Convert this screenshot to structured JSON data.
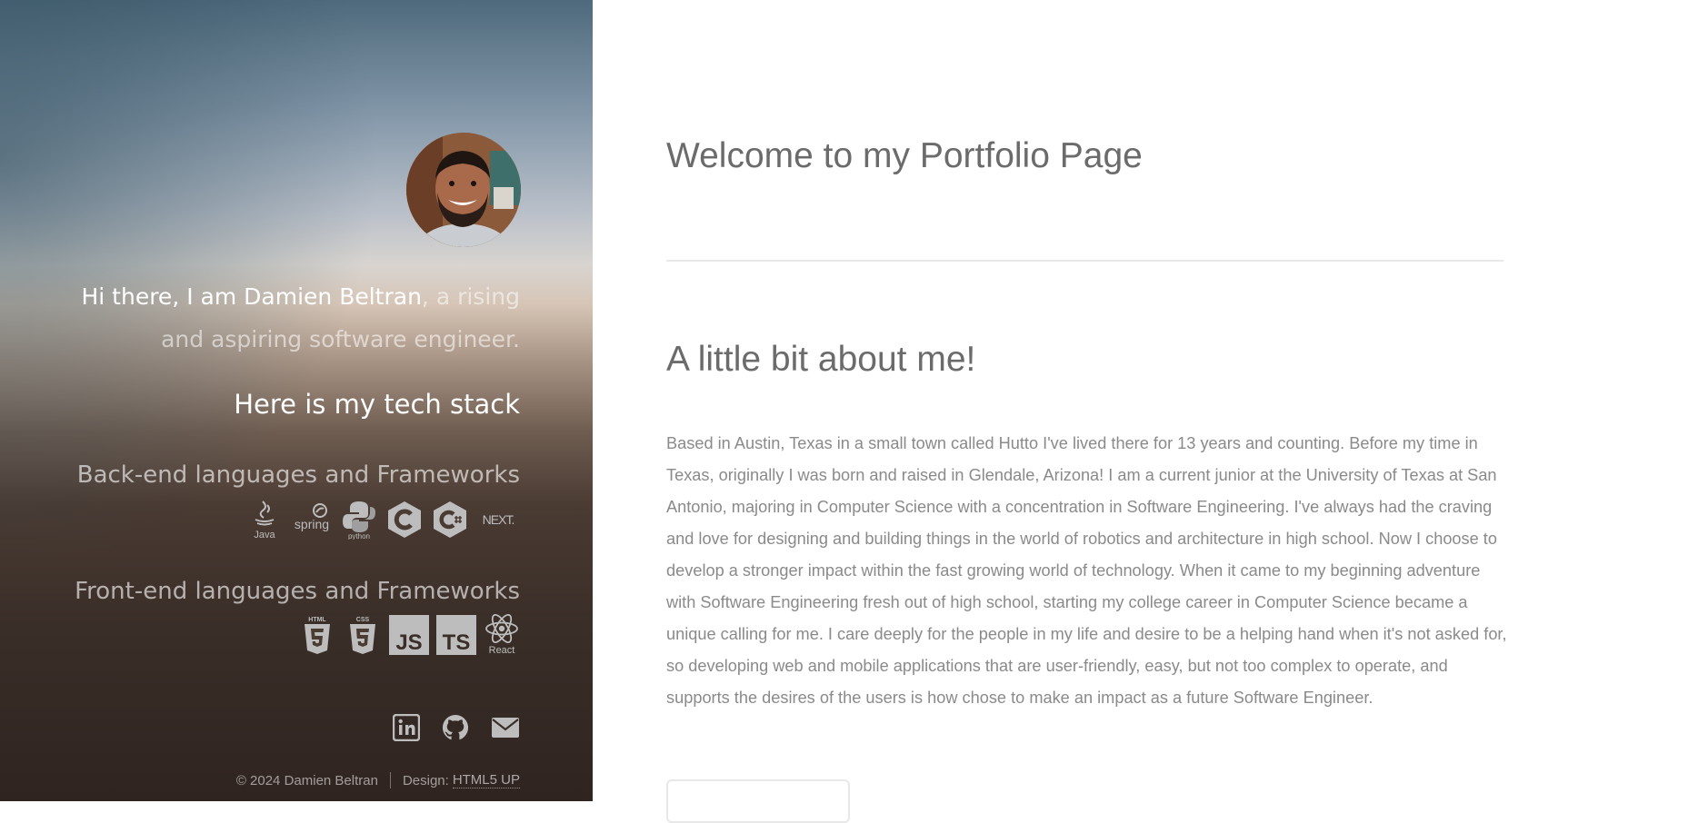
{
  "sidebar": {
    "intro_name": "Hi there, I am Damien Beltran",
    "intro_rest": ", a rising and aspiring software engineer.",
    "stack_title": "Here is my tech stack",
    "backend_title": "Back-end languages and Frameworks",
    "backend_icons": [
      "java-icon",
      "spring-icon",
      "python-icon",
      "c-icon",
      "csharp-icon",
      "nextjs-icon"
    ],
    "backend_labels": {
      "java": "Java",
      "spring": "spring",
      "python": "python",
      "next": "NEXT."
    },
    "frontend_title": "Front-end languages and Frameworks",
    "frontend_icons": [
      "html5-icon",
      "css3-icon",
      "javascript-icon",
      "typescript-icon",
      "react-icon"
    ],
    "frontend_labels": {
      "html": "HTML",
      "css": "CSS",
      "js": "JS",
      "ts": "TS",
      "react": "React"
    },
    "social_icons": [
      "linkedin-icon",
      "github-icon",
      "email-icon"
    ],
    "copyright": "© 2024 Damien Beltran",
    "design_label": "Design:",
    "design_link": "HTML5 UP"
  },
  "main": {
    "page_title": "Welcome to my Portfolio Page",
    "about_title": "A little bit about me!",
    "about_text": "Based in Austin, Texas in a small town called Hutto I've lived there for 13 years and counting. Before my time in Texas, originally I was born and raised in Glendale, Arizona! I am a current junior at the University of Texas at San Antonio, majoring in Computer Science with a concentration in Software Engineering. I've always had the craving and love for designing and building things in the world of robotics and architecture in high school. Now I choose to develop a stronger impact within the fast growing world of technology. When it came to my beginning adventure with Software Engineering fresh out of high school, starting my college career in Computer Science became a unique calling for me. I care deeply for the people in my life and desire to be a helping hand when it's not asked for, so developing web and mobile applications that are user-friendly, easy, but not too complex to operate, and supports the desires of the users is how chose to make an impact as a future Software Engineer."
  },
  "colors": {
    "heading": "#6b6b6b",
    "body_text": "#8a8a8a",
    "divider": "#e8e8e8",
    "sidebar_text": "#ffffff"
  }
}
